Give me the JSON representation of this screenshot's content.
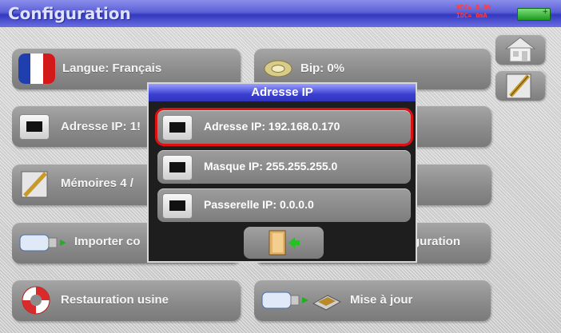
{
  "header": {
    "title": "Configuration",
    "vdc": "VDC= 0.0V",
    "idc": "IDC= 0mA",
    "battery_sign": "+"
  },
  "tiles": {
    "langue": "Langue: Français",
    "bip": "Bip: 0%",
    "adresse_ip": "Adresse IP: 1!",
    "memoires": "Mémoires 4 /",
    "importer": "Importer co",
    "exporter": "guration",
    "restauration": "Restauration usine",
    "mise_a_jour": "Mise à jour"
  },
  "dialog": {
    "title": "Adresse IP",
    "items": [
      {
        "label": "Adresse IP: 192.168.0.170",
        "selected": true
      },
      {
        "label": "Masque IP: 255.255.255.0",
        "selected": false
      },
      {
        "label": "Passerelle IP: 0.0.0.0",
        "selected": false
      }
    ]
  },
  "icons": {
    "language": "france-flag-icon",
    "bip": "speaker-icon",
    "network": "ethernet-port-icon",
    "memory": "pen-document-icon",
    "import": "usb-drive-icon",
    "restore": "lifebuoy-icon",
    "update": "usb-chip-icon",
    "home": "home-icon",
    "edit": "pen-document-icon",
    "exit": "exit-door-icon"
  },
  "colors": {
    "title_bar": "#4a4fd0",
    "selected_outline": "#e01010",
    "meter_text": "#ff3b3b",
    "battery": "#2fb52f"
  }
}
